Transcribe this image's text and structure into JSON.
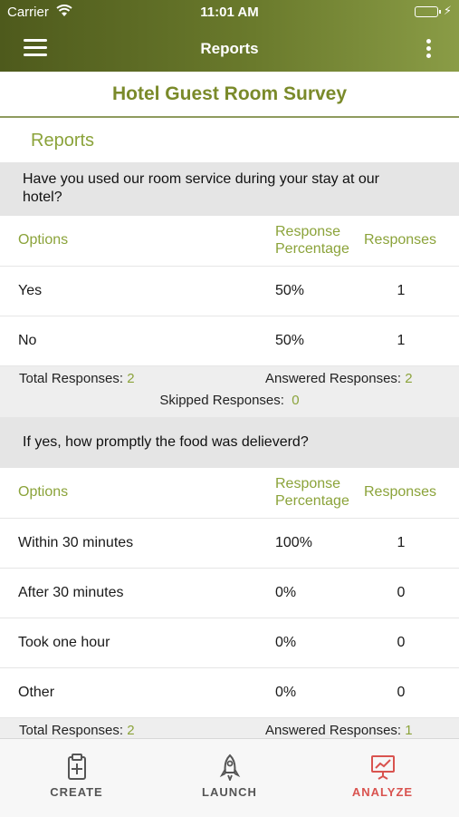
{
  "status_bar": {
    "carrier": "Carrier",
    "time": "11:01 AM"
  },
  "nav": {
    "title": "Reports"
  },
  "survey_title": "Hotel Guest Room Survey",
  "section_heading": "Reports",
  "table_headers": {
    "options": "Options",
    "percentage": "Response Percentage",
    "responses": "Responses"
  },
  "questions": [
    {
      "text": "Have you used our room service during your stay at our hotel?",
      "rows": [
        {
          "option": "Yes",
          "percentage": "50%",
          "responses": "1"
        },
        {
          "option": "No",
          "percentage": "50%",
          "responses": "1"
        }
      ],
      "totals": {
        "total_label": "Total Responses:",
        "total_value": "2",
        "answered_label": "Answered Responses:",
        "answered_value": "2",
        "skipped_label": "Skipped Responses:",
        "skipped_value": "0"
      }
    },
    {
      "text": "If yes, how promptly the food was delieverd?",
      "rows": [
        {
          "option": "Within 30 minutes",
          "percentage": "100%",
          "responses": "1"
        },
        {
          "option": "After 30 minutes",
          "percentage": "0%",
          "responses": "0"
        },
        {
          "option": "Took one hour",
          "percentage": "0%",
          "responses": "0"
        },
        {
          "option": "Other",
          "percentage": "0%",
          "responses": "0"
        }
      ],
      "totals": {
        "total_label": "Total Responses:",
        "total_value": "2",
        "answered_label": "Answered Responses:",
        "answered_value": "1"
      }
    }
  ],
  "tabs": [
    {
      "label": "CREATE",
      "icon": "create-clipboard-icon",
      "active": false
    },
    {
      "label": "LAUNCH",
      "icon": "rocket-icon",
      "active": false
    },
    {
      "label": "ANALYZE",
      "icon": "chart-board-icon",
      "active": true
    }
  ],
  "colors": {
    "header_green_dark": "#4e5a1c",
    "header_green_light": "#8a9c46",
    "accent_green": "#8ba33a",
    "active_tab": "#d9534f"
  }
}
